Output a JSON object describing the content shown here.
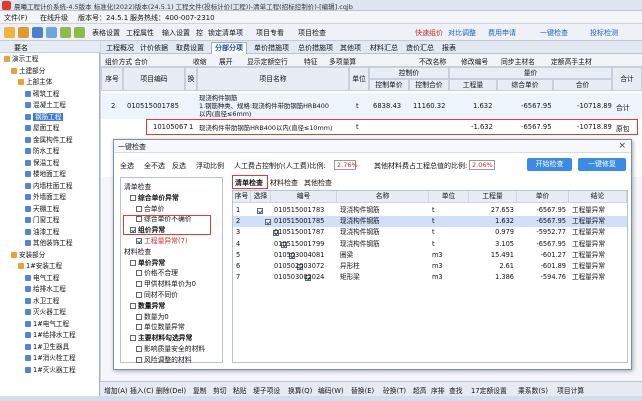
{
  "titlebar": {
    "text": "晨曦工程计价系统-4.5版本 标准化(2022)版本(24.5.1) 工程文件(投标计价(工程))-清单工程(招标控制价)-[编辑].cqjb"
  },
  "menu": {
    "file": "文件(F)",
    "online": "在线升级",
    "version_label": "版本号：24.5.1",
    "phone": "服务热线：400-007-2310"
  },
  "toolbar": {
    "table_settings": "表格设置",
    "project_props": "工程属性",
    "import_settings": "输入设置",
    "control": "控",
    "lock_list": "锁定清单项",
    "name_label": "项目专看",
    "project_check": "项目检查",
    "quick_price": "快速组价",
    "compare": "对比调整",
    "fee_apply": "费用申请",
    "onekey_check": "一键检查",
    "bid_inspect": "投标检测"
  },
  "left_panel": {
    "header": "要名",
    "tree": [
      {
        "label": "演示工程",
        "indent": 0
      },
      {
        "label": "土建部分",
        "indent": 1
      },
      {
        "label": "上部主体",
        "indent": 2
      },
      {
        "label": "砌筑工程",
        "indent": 3
      },
      {
        "label": "混凝土工程",
        "indent": 3
      },
      {
        "label": "钢筋工程",
        "indent": 3,
        "selected": true
      },
      {
        "label": "屋面工程",
        "indent": 3
      },
      {
        "label": "金属构件工程",
        "indent": 3
      },
      {
        "label": "防水工程",
        "indent": 3
      },
      {
        "label": "保温工程",
        "indent": 3
      },
      {
        "label": "楼地面工程",
        "indent": 3
      },
      {
        "label": "内墙柱面工程",
        "indent": 3
      },
      {
        "label": "外墙面工程",
        "indent": 3
      },
      {
        "label": "天棚工程",
        "indent": 3
      },
      {
        "label": "门窗工程",
        "indent": 3
      },
      {
        "label": "油漆工程",
        "indent": 3
      },
      {
        "label": "其他装饰工程",
        "indent": 3
      },
      {
        "label": "安装部分",
        "indent": 1
      },
      {
        "label": "1#安装工程",
        "indent": 2
      },
      {
        "label": "电气工程",
        "indent": 3
      },
      {
        "label": "给排水工程",
        "indent": 3
      },
      {
        "label": "水卫工程",
        "indent": 3
      },
      {
        "label": "灭火器工程",
        "indent": 3
      },
      {
        "label": "1#电气工程",
        "indent": 3
      },
      {
        "label": "1#给排水工程",
        "indent": 3
      },
      {
        "label": "1#卫生器具",
        "indent": 3
      },
      {
        "label": "1#消火栓工程",
        "indent": 3
      },
      {
        "label": "1#灭火器工程",
        "indent": 3
      }
    ]
  },
  "main_tabs": [
    "工程概况",
    "计价依据",
    "取费设置",
    "分部分项",
    "单价措施项",
    "总价措施项",
    "其他项",
    "材料汇总",
    "造价汇总",
    "报表"
  ],
  "main_tab_active": "分部分项",
  "subbar": {
    "group": "组价方式 合价",
    "collapse": "收缩",
    "expand": "展开",
    "show_quota_row": "显示定额空行",
    "feature": "特征",
    "multi_quantity": "多项量算",
    "no_wrap": "不改名称",
    "modify_code": "修改编号",
    "sync_main": "同步主材名",
    "quota_name": "定额高手主材"
  },
  "grid": {
    "headers": {
      "seq": "序号",
      "code": "项目编码",
      "change": "换",
      "name": "项目名称",
      "unit": "单位",
      "control_price": "控制价",
      "ctrl_unit": "控制单价",
      "ctrl_total": "控制合价",
      "quantity_group": "量价",
      "qty": "工程量",
      "unit_price": "综合单价",
      "total": "合价",
      "extra": "合计"
    },
    "rows": [
      {
        "seq": "2",
        "code": "010515001785",
        "name": "现浇构件钢筋\n1.钢筋种类、规格:现浇构件带肋钢筋HRB400\n以内(直径≤6mm)",
        "unit": "t",
        "ctrl_unit": "6838.43",
        "ctrl_total": "11160.32",
        "qty": "1.632",
        "unit_price": "-6567.95",
        "total": "-10718.89",
        "extra": "合计"
      },
      {
        "seq": "",
        "code": "10105067",
        "change": "1",
        "name": "现浇构件带肋钢筋HRB400以内(直径≤10mm)",
        "unit": "t",
        "ctrl_unit": "",
        "ctrl_total": "",
        "qty": "-1.632",
        "unit_price": "-6567.95",
        "total": "-10718.89",
        "extra": "原包"
      }
    ]
  },
  "dialog": {
    "title": "一键检查",
    "close": "×",
    "select_all": "全选",
    "select_none": "全不选",
    "invert": "反选",
    "float_ratio": "浮动比例",
    "labor_label": "人工费占控制价(人工费)比例:",
    "labor_value": "2.76%",
    "material_label": "其他材料费占工程总值的比例:",
    "material_value": "2.06%",
    "start_btn": "开始检查",
    "fix_btn": "一键修复",
    "left_tree": [
      {
        "label": "清单检查",
        "level": 0
      },
      {
        "label": "综合单价异常",
        "level": 1,
        "checked": false,
        "bold": true
      },
      {
        "label": "合单价",
        "level": 2,
        "checked": false
      },
      {
        "label": "综合单价不确价",
        "level": 2,
        "checked": false
      },
      {
        "label": "组价异常",
        "level": 1,
        "checked": true,
        "bold": true
      },
      {
        "label": "工程量异常(7)",
        "level": 2,
        "checked": true,
        "red": true
      },
      {
        "label": "材料检查",
        "level": 0
      },
      {
        "label": "单价异常",
        "level": 1,
        "checked": false,
        "bold": true
      },
      {
        "label": "价格不合理",
        "level": 2,
        "checked": false
      },
      {
        "label": "甲供材料单价为0",
        "level": 2,
        "checked": false
      },
      {
        "label": "同材不同价",
        "level": 2,
        "checked": false
      },
      {
        "label": "数量异常",
        "level": 1,
        "checked": false,
        "bold": true
      },
      {
        "label": "数量为0",
        "level": 2,
        "checked": false
      },
      {
        "label": "单位数量异常",
        "level": 2,
        "checked": false
      },
      {
        "label": "主要材料勾选异常",
        "level": 1,
        "checked": false,
        "bold": true
      },
      {
        "label": "影响质量安全的材料",
        "level": 2,
        "checked": false
      },
      {
        "label": "风险调整的材料",
        "level": 2,
        "checked": false
      }
    ],
    "tabs": [
      "清单检查",
      "材料检查",
      "其他检查"
    ],
    "table_headers": [
      "序号",
      "选择",
      "编号",
      "名称",
      "单位",
      "工程量",
      "单价",
      "结论"
    ],
    "table_rows": [
      {
        "seq": "1",
        "checked": true,
        "code": "010515001783",
        "name": "现浇构件钢筋",
        "unit": "t",
        "qty": "27.653",
        "price": "-6567.95",
        "result": "工程量异常"
      },
      {
        "seq": "2",
        "checked": true,
        "code": "010515001785",
        "name": "现浇构件钢筋",
        "unit": "t",
        "qty": "1.632",
        "price": "-6567.95",
        "result": "工程量异常"
      },
      {
        "seq": "3",
        "checked": true,
        "code": "010515001787",
        "name": "现浇构件钢筋",
        "unit": "t",
        "qty": "0.979",
        "price": "-5952.77",
        "result": "工程量异常"
      },
      {
        "seq": "4",
        "checked": true,
        "code": "010515001799",
        "name": "现浇构件钢筋",
        "unit": "t",
        "qty": "3.105",
        "price": "-6567.95",
        "result": "工程量异常"
      },
      {
        "seq": "5",
        "checked": true,
        "code": "010503004081",
        "name": "圈梁",
        "unit": "m3",
        "qty": "15.491",
        "price": "-601.27",
        "result": "工程量异常"
      },
      {
        "seq": "6",
        "checked": true,
        "code": "010502003072",
        "name": "异形柱",
        "unit": "m3",
        "qty": "2.61",
        "price": "-601.89",
        "result": "工程量异常"
      },
      {
        "seq": "7",
        "checked": true,
        "code": "010503002024",
        "name": "矩形梁",
        "unit": "m3",
        "qty": "1.386",
        "price": "-594.76",
        "result": "工程量异常"
      }
    ]
  },
  "statusbar": {
    "add": "增加(A)",
    "insert": "插入(C)",
    "delete": "删除(Del)",
    "copy": "复制",
    "cut": "剪切",
    "paste": "粘贴",
    "fill": "埂子项设",
    "convert": "换算(Q)",
    "reorder": "编码(W)",
    "replace": "替换(E)",
    "borrow": "砼换(T)",
    "high": "超高",
    "sort": "序排",
    "find": "查找",
    "quota_set": "17定额设置",
    "rate": "乘系数(S)",
    "project_calc": "项目计算"
  }
}
